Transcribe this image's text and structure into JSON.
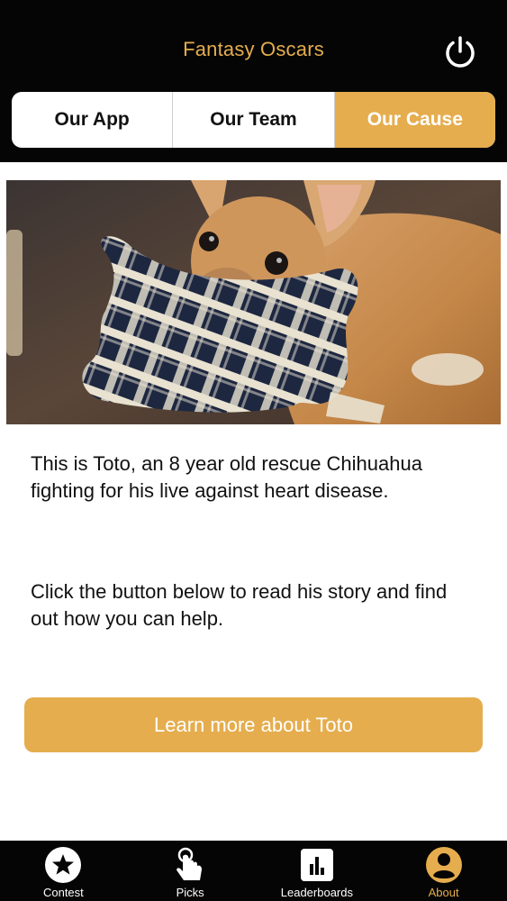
{
  "header": {
    "title": "Fantasy Oscars",
    "power_icon": "power-icon"
  },
  "segments": [
    {
      "label": "Our App",
      "active": false
    },
    {
      "label": "Our Team",
      "active": false
    },
    {
      "label": "Our Cause",
      "active": true
    }
  ],
  "content": {
    "photo_subject": "chihuahua-with-plaid-bone-toy",
    "paragraph1": "This is Toto, an 8 year old rescue Chihuahua fighting for his live against heart disease.",
    "paragraph2": "Click the button below to read his story and find out how you can help.",
    "button_label": "Learn more about Toto"
  },
  "tabbar": {
    "items": [
      {
        "label": "Contest",
        "icon": "star-icon",
        "active": false
      },
      {
        "label": "Picks",
        "icon": "hand-pointer-icon",
        "active": false
      },
      {
        "label": "Leaderboards",
        "icon": "bar-chart-icon",
        "active": false
      },
      {
        "label": "About",
        "icon": "user-icon",
        "active": true
      }
    ]
  },
  "colors": {
    "accent": "#e5ad4e",
    "bar_background": "#050505",
    "text": "#111111"
  }
}
